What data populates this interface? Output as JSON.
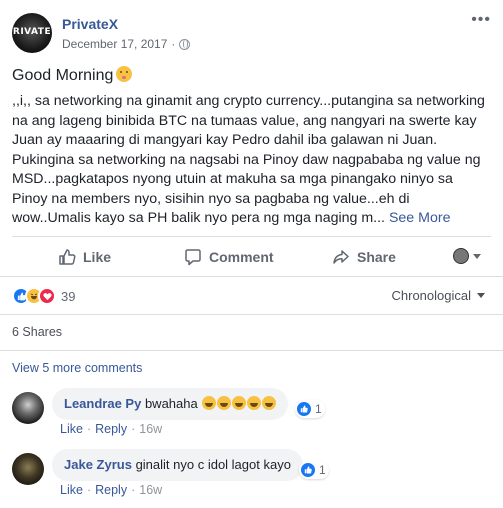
{
  "post": {
    "author": "PrivateX",
    "avatar_text": "RIVATE",
    "date": "December 17, 2017",
    "separator": "·",
    "more_menu": "•••",
    "greeting": "Good Morning",
    "body": ",,i,, sa networking na ginamit ang crypto currency...putangina sa networking na ang lageng binibida BTC na tumaas value, ang nangyari na swerte kay Juan ay maaaring di mangyari kay Pedro dahil iba galawan ni Juan. Pukingina sa networking na nagsabi na Pinoy daw nagpababa ng value ng MSD...pagkatapos nyong utuin at makuha sa mga pinangako ninyo sa Pinoy na members nyo, sisihin nyo sa pagbaba ng value...eh di wow..Umalis kayo sa PH balik nyo pera ng mga naging m...",
    "see_more": "See More"
  },
  "actions": {
    "like": "Like",
    "comment": "Comment",
    "share": "Share"
  },
  "reactions": {
    "count": "39",
    "types": [
      "like",
      "haha",
      "love"
    ]
  },
  "sort": {
    "label": "Chronological"
  },
  "shares": "6 Shares",
  "view_more_comments": "View 5 more comments",
  "comments": [
    {
      "name": "Leandrae Py",
      "text": "bwahaha",
      "emojis": 5,
      "reaction_count": "1",
      "like": "Like",
      "reply": "Reply",
      "time": "16w",
      "dot": "·"
    },
    {
      "name": "Jake Zyrus",
      "text": "ginalit nyo c idol lagot kayo",
      "reaction_count": "1",
      "like": "Like",
      "reply": "Reply",
      "time": "16w",
      "dot": "·"
    }
  ],
  "colors": {
    "link": "#385898",
    "like_blue": "#1877f2",
    "love_red": "#f0284a",
    "haha_yellow": "#f7c244"
  }
}
